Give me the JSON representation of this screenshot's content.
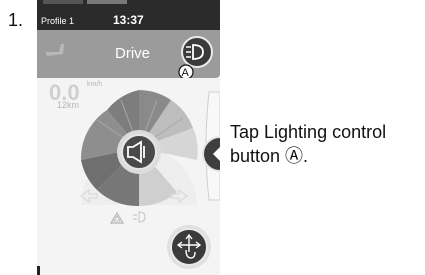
{
  "step": {
    "number": "1."
  },
  "status_bar": {
    "profile": "Profile 1",
    "time": "13:37"
  },
  "header": {
    "mode": "Drive"
  },
  "speed": {
    "value": "0.0",
    "unit": "km/h",
    "distance": "12km"
  },
  "callout": {
    "letter": "A"
  },
  "instruction": {
    "text": "Tap Lighting control button Ⓐ."
  },
  "icons": {
    "lighting": "headlight-icon",
    "horn": "horn-icon",
    "hazard": "hazard-icon",
    "indicators": "arrow-icon",
    "drive_mode": "hand-move-icon",
    "seat": "seat-icon"
  },
  "colors": {
    "screen_dark": "#3a3a3a",
    "screen_mid": "#8a8a8a",
    "header": "#9a9a9a",
    "panel": "#f2f2f2"
  }
}
